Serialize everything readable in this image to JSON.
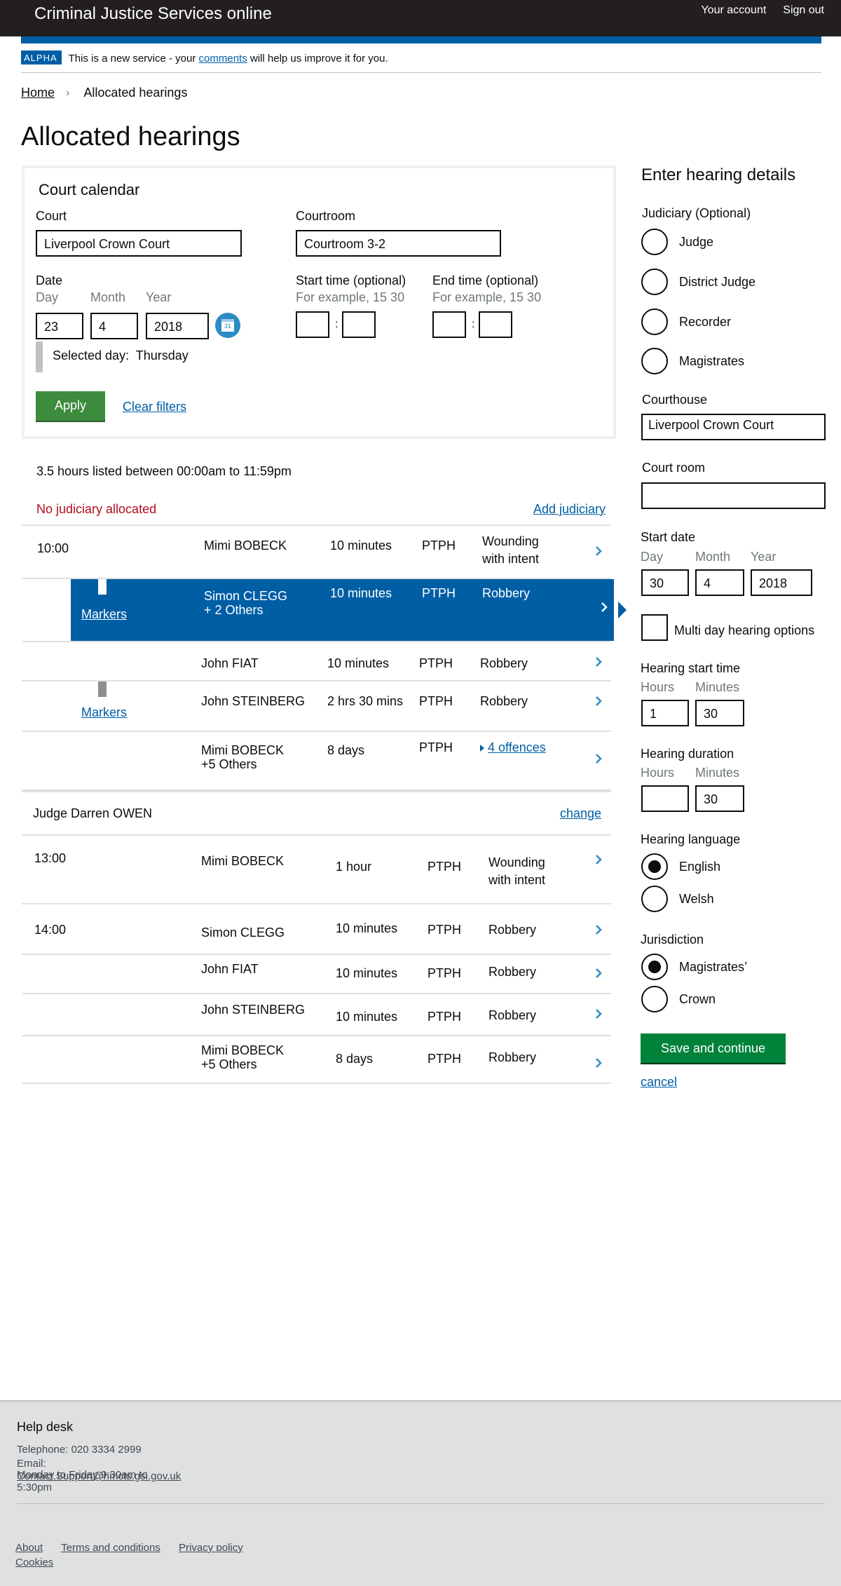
{
  "header": {
    "title": "Criminal Justice Services online",
    "account": "Your account",
    "signout": "Sign out"
  },
  "phase": {
    "tag": "ALPHA",
    "text_before": "This is a new service - your ",
    "link": "comments",
    "text_after": " will help us improve it for you."
  },
  "breadcrumb": {
    "home": "Home",
    "current": "Allocated hearings"
  },
  "page_title": "Allocated hearings",
  "calendar": {
    "heading": "Court calendar",
    "court_label": "Court",
    "court_value": "Liverpool Crown Court",
    "courtroom_label": "Courtroom",
    "courtroom_value": "Courtroom 3-2",
    "date_label": "Date",
    "day_hint": "Day",
    "month_hint": "Month",
    "year_hint": "Year",
    "day": "23",
    "month": "4",
    "year": "2018",
    "cal_icon_text": "31",
    "start_label": "Start time (optional)",
    "end_label": "End time (optional)",
    "time_hint": "For example, 15 30",
    "colon": ":",
    "selected_day_label": "Selected day:",
    "selected_day": "Thursday",
    "apply": "Apply",
    "clear": "Clear filters"
  },
  "summary": "3.5 hours listed between 00:00am to 11:59pm",
  "no_judiciary": "No judiciary allocated",
  "add_judiciary": "Add judiciary",
  "markers_label": "Markers",
  "group1": [
    {
      "time": "10:00",
      "name": "Mimi BOBECK",
      "duration": "10 minutes",
      "type": "PTPH",
      "offence": "Wounding with intent"
    },
    {
      "time": "",
      "name": "Simon CLEGG",
      "name2": "+ 2 Others",
      "duration": "10 minutes",
      "type": "PTPH",
      "offence": "Robbery"
    },
    {
      "time": "",
      "name": "John FIAT",
      "duration": "10 minutes",
      "type": "PTPH",
      "offence": "Robbery"
    },
    {
      "time": "",
      "name": "John STEINBERG",
      "duration": "2 hrs 30 mins",
      "type": "PTPH",
      "offence": "Robbery"
    },
    {
      "time": "",
      "name": "Mimi BOBECK",
      "name2": "+5 Others",
      "duration": "8 days",
      "type": "PTPH",
      "offence": "4 offences"
    }
  ],
  "judge": {
    "name": "Judge Darren OWEN",
    "change": "change"
  },
  "group2": [
    {
      "time": "13:00",
      "name": "Mimi BOBECK",
      "duration": "1 hour",
      "type": "PTPH",
      "offence": "Wounding with intent"
    },
    {
      "time": "14:00",
      "name": "Simon CLEGG",
      "duration": "10 minutes",
      "type": "PTPH",
      "offence": "Robbery"
    },
    {
      "time": "",
      "name": "John FIAT",
      "duration": "10 minutes",
      "type": "PTPH",
      "offence": "Robbery"
    },
    {
      "time": "",
      "name": "John STEINBERG",
      "duration": "10 minutes",
      "type": "PTPH",
      "offence": "Robbery"
    },
    {
      "time": "",
      "name": "Mimi BOBECK",
      "name2": "+5 Others",
      "duration": "8 days",
      "type": "PTPH",
      "offence": "Robbery"
    }
  ],
  "panel": {
    "heading": "Enter hearing details",
    "judiciary_label": "Judiciary (Optional)",
    "judiciary_options": [
      "Judge",
      "District Judge",
      "Recorder",
      "Magistrates"
    ],
    "courthouse_label": "Courthouse",
    "courthouse_value": "Liverpool Crown Court",
    "courtroom_label": "Court room",
    "courtroom_value": "",
    "start_date_label": "Start date",
    "day_hint": "Day",
    "month_hint": "Month",
    "year_hint": "Year",
    "day": "30",
    "month": "4",
    "year": "2018",
    "multi_day": "Multi day hearing options",
    "start_time_label": "Hearing start time",
    "hours_hint": "Hours",
    "minutes_hint": "Minutes",
    "start_hours": "1",
    "start_minutes": "30",
    "duration_label": "Hearing duration",
    "duration_hours": "",
    "duration_minutes": "30",
    "language_label": "Hearing language",
    "language_options": [
      "English",
      "Welsh"
    ],
    "language_selected": "English",
    "jurisdiction_label": "Jurisdiction",
    "jurisdiction_options": [
      "Magistrates’",
      "Crown"
    ],
    "jurisdiction_selected": "Magistrates’",
    "save": "Save and continue",
    "cancel": "cancel"
  },
  "footer": {
    "heading": "Help desk",
    "telephone": "Telephone: 020 3334 2999",
    "email_label": "Email:",
    "email": "Contact.Support@hmcts.gsi.gov.uk",
    "hours_a": "Monday to Friday 9:30am to",
    "hours_b": "5:30pm",
    "links": [
      "About",
      "Terms and conditions",
      "Privacy policy",
      "Cookies"
    ]
  },
  "colors": {
    "header_bg": "#231f20",
    "brand_blue": "#005ea5",
    "error_red": "#b10e1e",
    "apply_green": "#3d8b3d",
    "save_green": "#00823b",
    "marker_grey": "#8e8e8e"
  }
}
